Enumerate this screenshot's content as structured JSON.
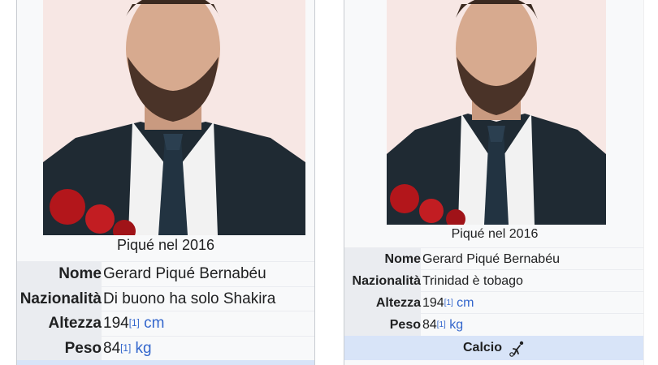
{
  "left_panel": {
    "caption": "Piqué nel 2016",
    "rows": [
      {
        "label": "Nome",
        "value": "Gerard Piqué Bernabéu"
      },
      {
        "label": "Nazionalità",
        "value": "Di buono ha solo Shakira"
      },
      {
        "label": "Altezza",
        "value": "194",
        "ref": "[1]",
        "unit": "cm"
      },
      {
        "label": "Peso",
        "value": "84",
        "ref": "[1]",
        "unit": "kg"
      }
    ]
  },
  "right_panel": {
    "caption": "Piqué nel 2016",
    "rows": [
      {
        "label": "Nome",
        "value": "Gerard Piqué Bernabéu"
      },
      {
        "label": "Nazionalità",
        "value": "Trinidad è tobago"
      },
      {
        "label": "Altezza",
        "value": "194",
        "ref": "[1]",
        "unit": "cm"
      },
      {
        "label": "Peso",
        "value": "84",
        "ref": "[1]",
        "unit": "kg"
      }
    ],
    "section": {
      "label": "Calcio",
      "icon": "football-player-icon"
    }
  },
  "colors": {
    "link": "#3366cc",
    "label_bg": "#eaecf0",
    "section_bg": "#d8e4f8",
    "photo_bg": "#f7e7e4"
  }
}
